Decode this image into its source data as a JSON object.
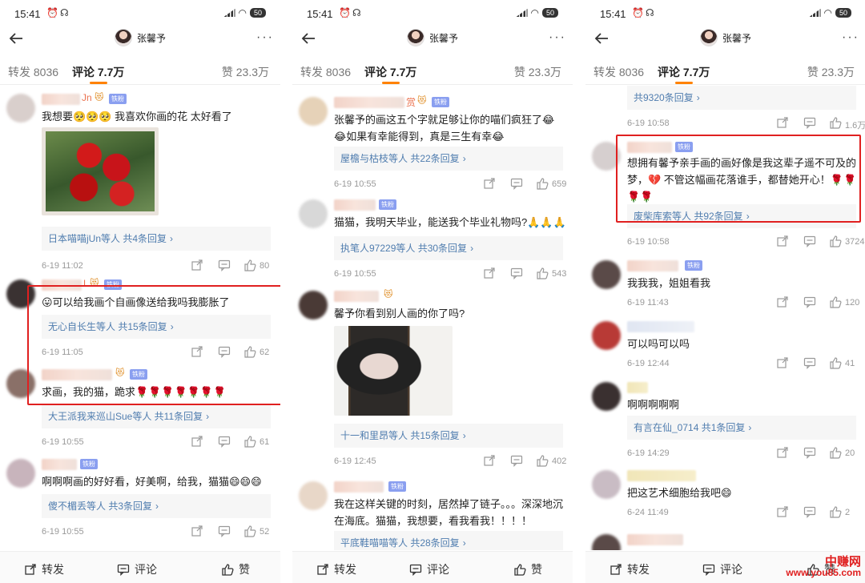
{
  "status": {
    "time": "15:41",
    "battery": "50"
  },
  "nav": {
    "name": "张馨予"
  },
  "tabs": {
    "repost": "转发 8036",
    "comment": "评论 7.7万",
    "like": "赞 23.3万"
  },
  "bottom": {
    "repost": "转发",
    "comment": "评论",
    "like": "赞"
  },
  "fan_badge": "铁粉",
  "watermark": {
    "line1": "中赚网",
    "line2": "www.you85.com"
  },
  "colors": {
    "accent": "#ff8200",
    "link": "#507daf",
    "highlight": "#e02020"
  },
  "panel1": {
    "c1": {
      "name_tail": "Jn",
      "text": "我想要🥺🥺🥺 我喜欢你画的花 太好看了",
      "replies": "日本喵喵jUn等人 共4条回复",
      "time": "6-19 11:02",
      "likes": "80"
    },
    "c2": {
      "name_tail": "L",
      "text": "😛可以给我画个自画像送给我吗我膨胀了",
      "replies": "无心自长生等人 共15条回复",
      "time": "6-19 11:05",
      "likes": "62"
    },
    "c3": {
      "text": "求画，我的猫，跪求🌹🌹🌹🌹🌹🌹🌹",
      "replies": "大王派我来巡山Sue等人 共11条回复",
      "time": "6-19 10:55",
      "likes": "61"
    },
    "c4": {
      "text": "啊啊啊画的好好看，好美啊，给我，猫猫😄😄😄",
      "replies": "傻不楣丢等人 共3条回复",
      "time": "6-19 10:55",
      "likes": "52"
    }
  },
  "panel2": {
    "c1": {
      "name_tail": "赏",
      "text": "张馨予的画这五个字就足够让你的喵们疯狂了😂😂如果有幸能得到，真是三生有幸😂",
      "replies": "屋檐与枯枝等人 共22条回复",
      "time": "6-19 10:55",
      "likes": "659"
    },
    "c2": {
      "text": "猫猫，我明天毕业，能送我个毕业礼物吗?🙏🙏🙏",
      "replies": "执笔人97229等人 共30条回复",
      "time": "6-19 10:55",
      "likes": "543"
    },
    "c3": {
      "text": "馨予你看到别人画的你了吗?",
      "replies": "十一和里昂等人 共15条回复",
      "time": "6-19 12:45",
      "likes": "402"
    },
    "c4": {
      "text": "我在这样关键的时刻，居然掉了链子。。。深深地沉在海底。猫猫，我想要，看我看我！！！！",
      "replies": "平底鞋喵喵等人 共28条回复"
    }
  },
  "panel3": {
    "c0": {
      "replies": "共9320条回复",
      "time": "6-19 10:58",
      "likes": "1.6万"
    },
    "c1": {
      "text": "想拥有馨予亲手画的画好像是我这辈子遥不可及的梦，💔  不管这幅画花落谁手，都替她开心！🌹🌹🌹🌹",
      "replies": "废柴库索等人 共92条回复",
      "time": "6-19 10:58",
      "likes": "3724"
    },
    "c2": {
      "text": "我我我，姐姐看我",
      "time": "6-19 11:43",
      "likes": "120"
    },
    "c3": {
      "text": "可以吗可以吗",
      "time": "6-19 12:44",
      "likes": "41"
    },
    "c4": {
      "text": "啊啊啊啊啊",
      "replies": "有言在仙_0714 共1条回复",
      "time": "6-19 14:29",
      "likes": "20"
    },
    "c5": {
      "text": "把这艺术细胞给我吧😄",
      "time": "6-24 11:49",
      "likes": "2"
    }
  }
}
